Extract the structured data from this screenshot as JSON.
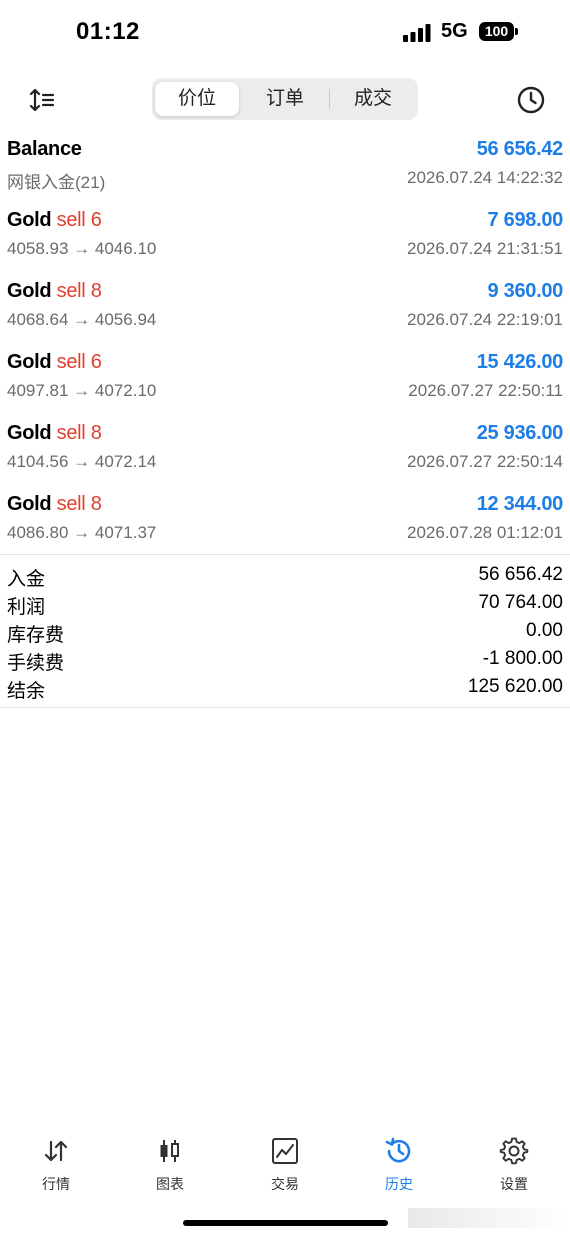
{
  "status_bar": {
    "time": "01:12",
    "network": "5G",
    "battery": "100"
  },
  "toolbar": {
    "tabs": [
      {
        "label": "价位"
      },
      {
        "label": "订单"
      },
      {
        "label": "成交"
      }
    ],
    "active_tab": 0,
    "sort_icon": "sort-icon",
    "history_icon": "clock-icon"
  },
  "balance": {
    "title": "Balance",
    "amount": "56 656.42",
    "desc": "网银入金(21)",
    "datetime": "2026.07.24 14:22:32"
  },
  "trades": [
    {
      "symbol": "Gold",
      "side": "sell 6",
      "prices": "4058.93 → 4046.10",
      "profit": "7 698.00",
      "datetime": "2026.07.24 21:31:51"
    },
    {
      "symbol": "Gold",
      "side": "sell 8",
      "prices": "4068.64 → 4056.94",
      "profit": "9 360.00",
      "datetime": "2026.07.24 22:19:01"
    },
    {
      "symbol": "Gold",
      "side": "sell 6",
      "prices": "4097.81 → 4072.10",
      "profit": "15 426.00",
      "datetime": "2026.07.27 22:50:11"
    },
    {
      "symbol": "Gold",
      "side": "sell 8",
      "prices": "4104.56 → 4072.14",
      "profit": "25 936.00",
      "datetime": "2026.07.27 22:50:14"
    },
    {
      "symbol": "Gold",
      "side": "sell 8",
      "prices": "4086.80 → 4071.37",
      "profit": "12 344.00",
      "datetime": "2026.07.28 01:12:01"
    }
  ],
  "summary": [
    {
      "label": "入金",
      "value": "56 656.42"
    },
    {
      "label": "利润",
      "value": "70 764.00"
    },
    {
      "label": "库存费",
      "value": "0.00"
    },
    {
      "label": "手续费",
      "value": "-1 800.00"
    },
    {
      "label": "结余",
      "value": "125 620.00"
    }
  ],
  "tabbar": [
    {
      "label": "行情",
      "icon": "quotes-arrows-icon"
    },
    {
      "label": "图表",
      "icon": "candlestick-chart-icon"
    },
    {
      "label": "交易",
      "icon": "trade-chart-icon"
    },
    {
      "label": "历史",
      "icon": "history-clock-icon"
    },
    {
      "label": "设置",
      "icon": "gear-icon"
    }
  ],
  "colors": {
    "accent": "#1f7ee6",
    "sell": "#e0412f",
    "secondary_text": "#6b6b6b"
  }
}
